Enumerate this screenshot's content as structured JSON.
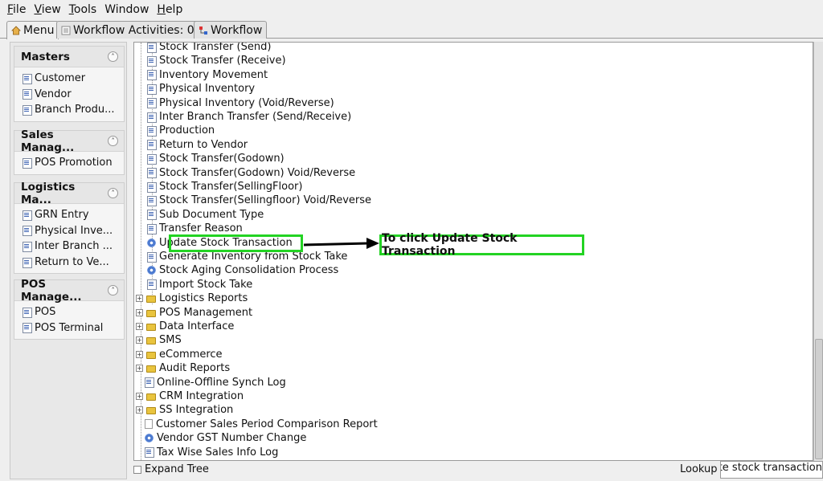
{
  "menubar": {
    "items": [
      {
        "u": "F",
        "rest": "ile"
      },
      {
        "u": "V",
        "rest": "iew"
      },
      {
        "u": "T",
        "rest": "ools"
      },
      {
        "u": "",
        "rest": "Window"
      },
      {
        "u": "H",
        "rest": "elp"
      }
    ]
  },
  "tabs": {
    "menu": "Menu",
    "workflow_activities": "Workflow Activities: 0",
    "workflow": "Workflow"
  },
  "sidebar": {
    "groups": [
      {
        "title": "Masters",
        "items": [
          "Customer",
          "Vendor",
          "Branch Produ..."
        ]
      },
      {
        "title": "Sales Manag...",
        "items": [
          "POS Promotion"
        ]
      },
      {
        "title": "Logistics Ma...",
        "items": [
          "GRN Entry",
          "Physical Inve...",
          "Inter Branch ...",
          "Return to Ve..."
        ]
      },
      {
        "title": "POS Manage...",
        "items": [
          "POS",
          "POS Terminal"
        ]
      }
    ]
  },
  "tree": {
    "children": [
      {
        "label": "Stock Transfer (Send)",
        "icon": "document-icon"
      },
      {
        "label": "Stock Transfer (Receive)",
        "icon": "document-icon"
      },
      {
        "label": "Inventory Movement",
        "icon": "document-icon"
      },
      {
        "label": "Physical Inventory",
        "icon": "document-icon"
      },
      {
        "label": "Physical Inventory (Void/Reverse)",
        "icon": "document-icon"
      },
      {
        "label": "Inter Branch Transfer (Send/Receive)",
        "icon": "document-icon"
      },
      {
        "label": "Production",
        "icon": "document-icon"
      },
      {
        "label": "Return to Vendor",
        "icon": "document-icon"
      },
      {
        "label": "Stock Transfer(Godown)",
        "icon": "document-icon"
      },
      {
        "label": "Stock Transfer(Godown) Void/Reverse",
        "icon": "document-icon"
      },
      {
        "label": "Stock Transfer(SellingFloor)",
        "icon": "document-icon"
      },
      {
        "label": "Stock Transfer(Sellingfloor) Void/Reverse",
        "icon": "document-icon"
      },
      {
        "label": "Sub Document Type",
        "icon": "document-icon"
      },
      {
        "label": "Transfer Reason",
        "icon": "document-icon"
      },
      {
        "label": "Update Stock Transaction",
        "icon": "gear-icon"
      },
      {
        "label": "Generate Inventory from Stock Take",
        "icon": "document-icon"
      },
      {
        "label": "Stock Aging Consolidation Process",
        "icon": "gear-icon"
      },
      {
        "label": "Import Stock Take",
        "icon": "document-icon"
      }
    ],
    "top": [
      {
        "label": "Logistics Reports",
        "icon": "folder-icon",
        "expandable": true
      },
      {
        "label": "POS Management",
        "icon": "folder-icon",
        "expandable": true
      },
      {
        "label": "Data Interface",
        "icon": "folder-icon",
        "expandable": true
      },
      {
        "label": "SMS",
        "icon": "folder-icon",
        "expandable": true
      },
      {
        "label": "eCommerce",
        "icon": "folder-icon",
        "expandable": true
      },
      {
        "label": "Audit Reports",
        "icon": "folder-icon",
        "expandable": true
      },
      {
        "label": "Online-Offline Synch Log",
        "icon": "document-icon",
        "expandable": false
      },
      {
        "label": "CRM Integration",
        "icon": "folder-icon",
        "expandable": true
      },
      {
        "label": "SS Integration",
        "icon": "folder-icon",
        "expandable": true
      },
      {
        "label": "Customer Sales Period Comparison Report",
        "icon": "report-icon",
        "expandable": false
      },
      {
        "label": "Vendor GST Number Change",
        "icon": "gear-icon",
        "expandable": false
      },
      {
        "label": "Tax Wise Sales Info Log",
        "icon": "document-icon",
        "expandable": false
      }
    ]
  },
  "annotation": {
    "callout": "To click Update Stock Transaction",
    "accent": "#23d323"
  },
  "statusbar": {
    "expand_tree": "Expand Tree",
    "lookup_label": "Lookup",
    "lookup_value": "ate stock transaction"
  }
}
